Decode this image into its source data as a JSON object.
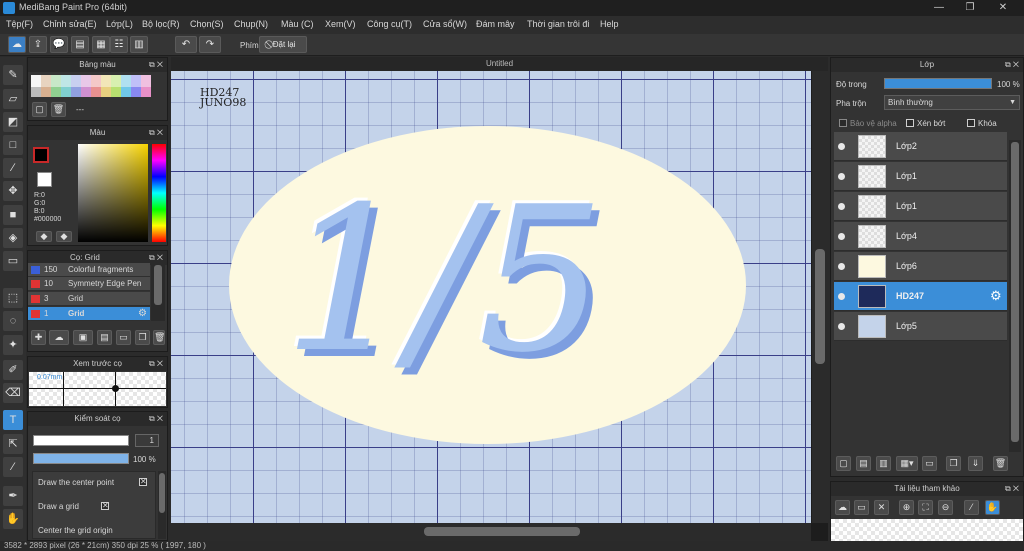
{
  "app": {
    "title": "MediBang Paint Pro (64bit)"
  },
  "menu": [
    "Tệp(F)",
    "Chỉnh sửa(E)",
    "Lớp(L)",
    "Bộ lọc(R)",
    "Chọn(S)",
    "Chụp(N)",
    "Màu (C)",
    "Xem(V)",
    "Công cụ(T)",
    "Cửa sổ(W)",
    "Đám mây",
    "Thời gian trôi đi",
    "Help"
  ],
  "toolbar": {
    "shortcut_label": "Phím",
    "reset_label": "Đặt lại"
  },
  "palette_panel": {
    "title": "Bảng màu",
    "name_placeholder": "---"
  },
  "color_panel": {
    "title": "Màu",
    "r": "R:0",
    "g": "G:0",
    "b": "B:0",
    "hex": "#000000",
    "foreground": "#000000"
  },
  "brush_panel": {
    "title": "Cọ: Grid",
    "items": [
      {
        "color": "#3a5fd8",
        "size": "150",
        "name": "Colorful fragments"
      },
      {
        "color": "#e03434",
        "size": "10",
        "name": "Symmetry Edge Pen"
      },
      {
        "color": "#e03434",
        "size": "3",
        "name": "Grid"
      },
      {
        "color": "#e03434",
        "size": "1",
        "name": "Grid"
      }
    ]
  },
  "preview_panel": {
    "title": "Xem trước cọ",
    "size_label": "0.07mm"
  },
  "brush_control": {
    "title": "Kiểm soát cọ",
    "size_value": "1",
    "opacity_value": "100 %",
    "options": [
      "Draw the center point",
      "Draw a grid",
      "Center the grid origin"
    ]
  },
  "canvas": {
    "tab_title": "Untitled",
    "sig_line1": "HD247",
    "sig_line2": "JUNO98",
    "big_text_left": "1",
    "big_text_slash": "/",
    "big_text_right": "5"
  },
  "layer_panel": {
    "title": "Lớp",
    "opacity_label": "Độ trong",
    "opacity_value": "100 %",
    "blend_label": "Pha trộn",
    "blend_value": "Bình thường",
    "protect_alpha": "Bảo vệ alpha",
    "clipping": "Xén bớt",
    "lock": "Khóa",
    "layers": [
      {
        "name": "Lớp2",
        "selected": false
      },
      {
        "name": "Lớp1",
        "selected": false
      },
      {
        "name": "Lớp1",
        "selected": false
      },
      {
        "name": "Lớp4",
        "selected": false
      },
      {
        "name": "Lớp6",
        "selected": false
      },
      {
        "name": "HD247",
        "selected": true
      },
      {
        "name": "Lớp5",
        "selected": false
      }
    ]
  },
  "reference_panel": {
    "title": "Tài liệu tham khảo"
  },
  "status": {
    "text": "3582 * 2893 pixel  (26 * 21cm)  350 dpi  25 %  ( 1997, 180 )"
  }
}
